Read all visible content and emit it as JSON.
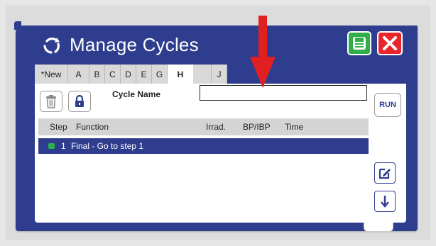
{
  "window": {
    "title": "Manage Cycles",
    "accent_color": "#2f3d8e",
    "save_icon": "save-icon",
    "close_icon": "close-icon"
  },
  "tabs": [
    {
      "label": "*New",
      "active": false
    },
    {
      "label": "A",
      "active": false
    },
    {
      "label": "B",
      "active": false
    },
    {
      "label": "C",
      "active": false
    },
    {
      "label": "D",
      "active": false
    },
    {
      "label": "E",
      "active": false
    },
    {
      "label": "G",
      "active": false
    },
    {
      "label": "H",
      "active": true
    },
    {
      "label": "",
      "active": false
    },
    {
      "label": "J",
      "active": false
    }
  ],
  "form": {
    "cycle_name_label": "Cycle Name",
    "cycle_name_value": ""
  },
  "buttons": {
    "run": "RUN",
    "delete_icon": "trash-icon",
    "lock_icon": "lock-icon",
    "edit_icon": "edit-icon",
    "move_down_icon": "arrow-down-icon"
  },
  "table": {
    "headers": {
      "step": "Step",
      "function": "Function",
      "irrad": "Irrad.",
      "bp": "BP/IBP",
      "time": "Time"
    },
    "rows": [
      {
        "step": "1",
        "function": "Final - Go to step 1"
      }
    ]
  },
  "annotation": {
    "arrow_color": "#e02020"
  }
}
